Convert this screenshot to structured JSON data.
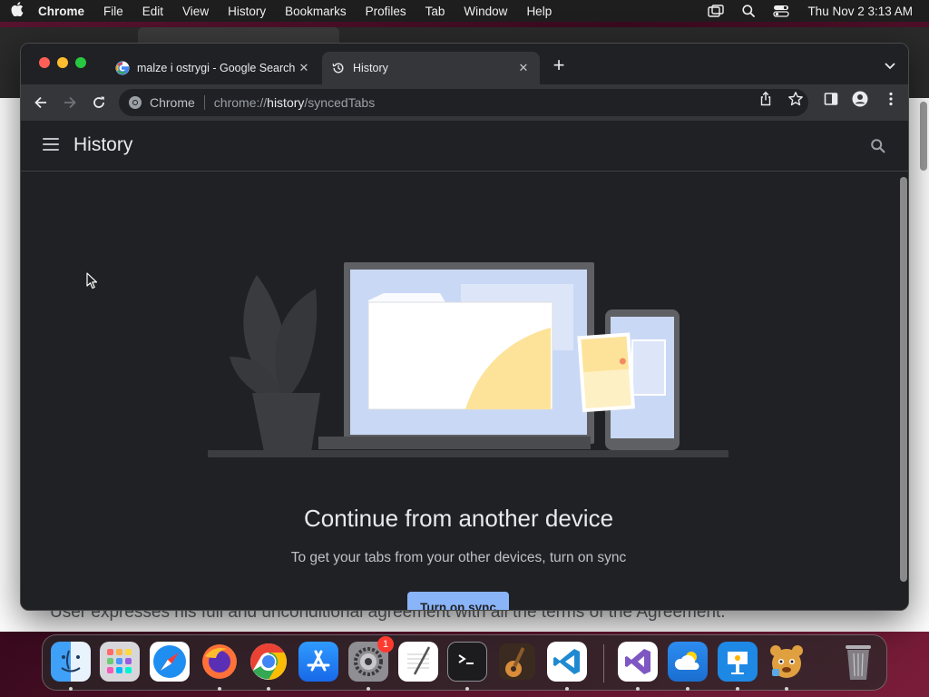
{
  "menubar": {
    "app_name": "Chrome",
    "items": [
      "File",
      "Edit",
      "View",
      "History",
      "Bookmarks",
      "Profiles",
      "Tab",
      "Window",
      "Help"
    ],
    "datetime": "Thu Nov 2  3:13 AM"
  },
  "background_window": {
    "text": "User expresses his full and unconditional agreement with all the terms of the Agreement."
  },
  "browser": {
    "tabs": [
      {
        "title": "malze i ostrygi - Google Search",
        "icon": "google-icon",
        "active": false
      },
      {
        "title": "History",
        "icon": "history-icon",
        "active": true
      }
    ],
    "omnibox": {
      "chip_label": "Chrome",
      "url_scheme": "chrome://",
      "url_host": "history",
      "url_path": "/syncedTabs"
    }
  },
  "history_page": {
    "title": "History",
    "heading": "Continue from another device",
    "subtext": "To get your tabs from your other devices, turn on sync",
    "sync_button": "Turn on sync"
  },
  "dock": {
    "apps": [
      "Finder",
      "Launchpad",
      "Safari",
      "Firefox",
      "Google Chrome",
      "App Store",
      "System Settings",
      "TextEdit",
      "Terminal",
      "GarageBand",
      "Visual Studio Code",
      "Visual Studio",
      "Weather",
      "Keynote",
      "Pet app",
      "Trash"
    ],
    "system_settings_badge": "1"
  },
  "colors": {
    "accent": "#8ab4f8",
    "page_bg": "#202124",
    "toolbar_bg": "#35363a"
  }
}
